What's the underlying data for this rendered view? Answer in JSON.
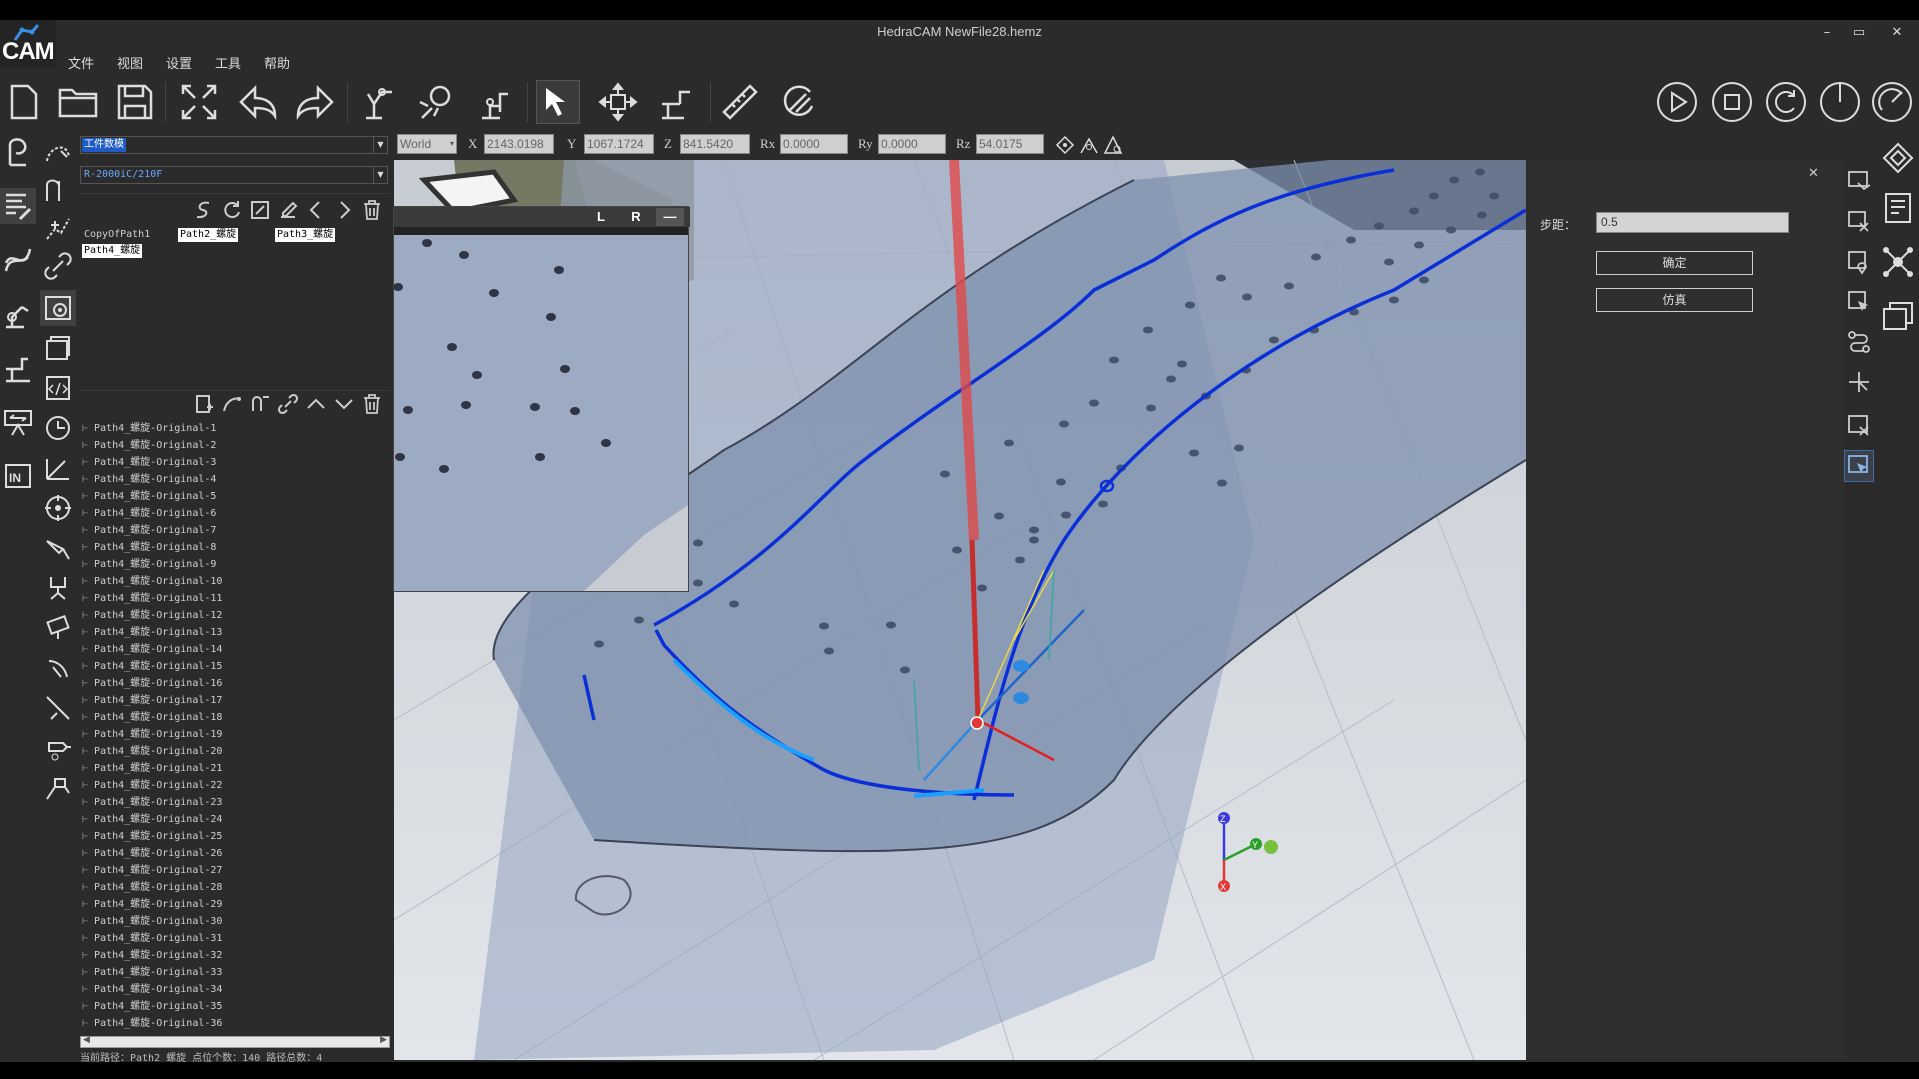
{
  "window": {
    "title": "HedraCAM  NewFile28.hemz",
    "logo_text": "CAM",
    "minimize": "–",
    "maximize": "▭",
    "close": "✕"
  },
  "menu": [
    "文件",
    "视图",
    "设置",
    "工具",
    "帮助"
  ],
  "toolbar": {
    "left_icons": [
      "new-file-icon",
      "open-folder-icon",
      "save-icon",
      "fit-view-icon",
      "undo-icon",
      "redo-icon",
      "robot-path-icon",
      "robot-weld-icon",
      "robot-tool-icon",
      "select-pointer-icon",
      "move-icon",
      "robot-base-icon",
      "ruler-icon",
      "rotate-snap-icon"
    ],
    "right_icons": [
      "play-icon",
      "stop-icon",
      "reset-icon",
      "timer-icon",
      "speed-icon"
    ]
  },
  "coords": {
    "frame": "World",
    "x_label": "X",
    "x": "2143.0198",
    "y_label": "Y",
    "y": "1067.1724",
    "z_label": "Z",
    "z": "841.5420",
    "rx_label": "Rx",
    "rx": "0.0000",
    "ry_label": "Ry",
    "ry": "0.0000",
    "rz_label": "Rz",
    "rz": "54.0175"
  },
  "left_panel": {
    "workpiece_select": "工件数模",
    "robot_select": "R-2000iC/210F",
    "path_tabs": [
      "CopyOfPath1",
      "Path2_螺旋",
      "Path3_螺旋",
      "Path4_螺旋"
    ],
    "list_items": [
      "Path4_螺旋-Original-1",
      "Path4_螺旋-Original-2",
      "Path4_螺旋-Original-3",
      "Path4_螺旋-Original-4",
      "Path4_螺旋-Original-5",
      "Path4_螺旋-Original-6",
      "Path4_螺旋-Original-7",
      "Path4_螺旋-Original-8",
      "Path4_螺旋-Original-9",
      "Path4_螺旋-Original-10",
      "Path4_螺旋-Original-11",
      "Path4_螺旋-Original-12",
      "Path4_螺旋-Original-13",
      "Path4_螺旋-Original-14",
      "Path4_螺旋-Original-15",
      "Path4_螺旋-Original-16",
      "Path4_螺旋-Original-17",
      "Path4_螺旋-Original-18",
      "Path4_螺旋-Original-19",
      "Path4_螺旋-Original-20",
      "Path4_螺旋-Original-21",
      "Path4_螺旋-Original-22",
      "Path4_螺旋-Original-23",
      "Path4_螺旋-Original-24",
      "Path4_螺旋-Original-25",
      "Path4_螺旋-Original-26",
      "Path4_螺旋-Original-27",
      "Path4_螺旋-Original-28",
      "Path4_螺旋-Original-29",
      "Path4_螺旋-Original-30",
      "Path4_螺旋-Original-31",
      "Path4_螺旋-Original-32",
      "Path4_螺旋-Original-33",
      "Path4_螺旋-Original-34",
      "Path4_螺旋-Original-35",
      "Path4_螺旋-Original-36"
    ],
    "status": "当前路径：Path2_螺旋  点位个数：140  路径总数：4"
  },
  "mini_view": {
    "left_btn": "L",
    "right_btn": "R",
    "minimize_btn": "—"
  },
  "right_panel": {
    "step_label": "步距：",
    "step_value": "0.5",
    "confirm": "确定",
    "simulate": "仿真",
    "close": "✕"
  },
  "axis_triad": {
    "z": "Z",
    "y": "Y",
    "x": "X"
  },
  "colors": {
    "accent_blue": "#1e5bc6",
    "path_blue": "#0a2fd8",
    "path_light": "#1aa0ff",
    "tool_red": "#e04040"
  }
}
